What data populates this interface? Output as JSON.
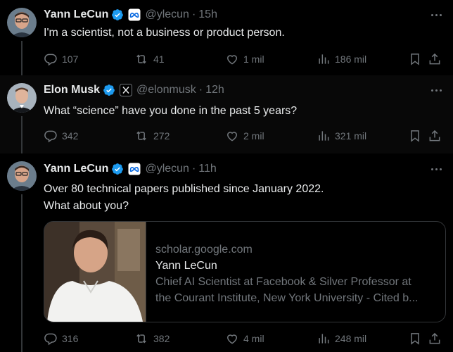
{
  "tweets": [
    {
      "name": "Yann LeCun",
      "handle": "@ylecun",
      "time": "15h",
      "text": "I'm a scientist, not a business or product person.",
      "replies": "107",
      "retweets": "41",
      "likes": "1 mil",
      "views": "186 mil",
      "affiliation_icon": "meta-logo-icon"
    },
    {
      "name": "Elon Musk",
      "handle": "@elonmusk",
      "time": "12h",
      "text": "What “science” have you done in the past 5 years?",
      "replies": "342",
      "retweets": "272",
      "likes": "2 mil",
      "views": "321 mil",
      "affiliation_icon": "x-logo-icon"
    },
    {
      "name": "Yann LeCun",
      "handle": "@ylecun",
      "time": "11h",
      "text_line1": "Over 80 technical papers published since January 2022.",
      "text_line2": "What about you?",
      "replies": "316",
      "retweets": "382",
      "likes": "4 mil",
      "views": "248 mil",
      "affiliation_icon": "meta-logo-icon",
      "card": {
        "domain": "scholar.google.com",
        "title": "Yann LeCun",
        "desc_line1": "Chief AI Scientist at Facebook & Silver Professor at",
        "desc_line2": "the Courant Institute, New York University - Cited b..."
      }
    }
  ],
  "separator": "·",
  "colors": {
    "verified": "#1d9bf0",
    "muted": "#71767b",
    "text": "#e7e9ea",
    "background": "#000000",
    "line": "#333639"
  }
}
